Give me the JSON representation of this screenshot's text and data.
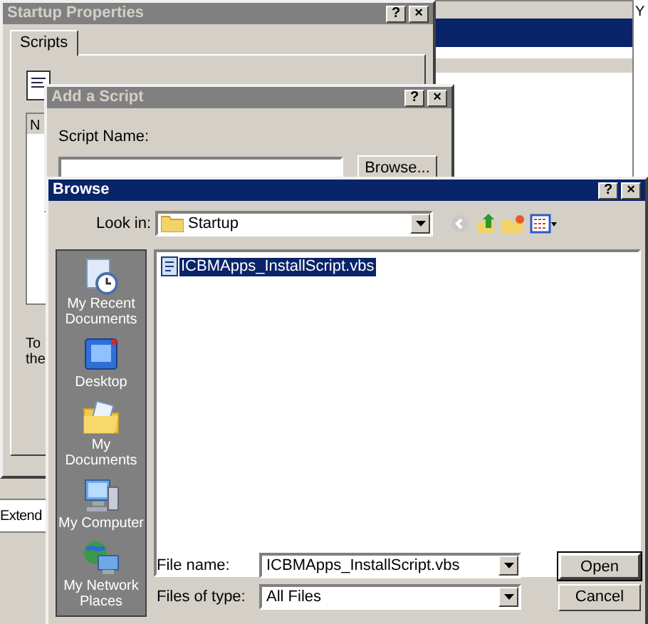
{
  "background_window": {
    "partial_text": "Y",
    "status_text": "Extend"
  },
  "startup_properties": {
    "title": "Startup Properties",
    "active": false,
    "title_buttons": [
      "?",
      "×"
    ],
    "tabs": [
      {
        "label": "Scripts",
        "selected": true
      }
    ],
    "list_header": "N",
    "partial_text_lines": [
      "To",
      "the"
    ]
  },
  "add_script": {
    "title": "Add a Script",
    "active": false,
    "title_buttons": [
      "?",
      "×"
    ],
    "script_name_label": "Script Name:",
    "browse_button": "Browse..."
  },
  "browse": {
    "title": "Browse",
    "active": true,
    "title_buttons": [
      "?",
      "×"
    ],
    "look_in_label": "Look in:",
    "look_in_value": "Startup",
    "places": [
      {
        "label": "My Recent Documents",
        "kind": "recent"
      },
      {
        "label": "Desktop",
        "kind": "desktop"
      },
      {
        "label": "My Documents",
        "kind": "documents"
      },
      {
        "label": "My Computer",
        "kind": "computer"
      },
      {
        "label": "My Network Places",
        "kind": "network"
      }
    ],
    "files": [
      {
        "name": "ICBMApps_InstallScript.vbs",
        "selected": true
      }
    ],
    "file_name_label": "File name:",
    "file_name_value": "ICBMApps_InstallScript.vbs",
    "files_of_type_label": "Files of type:",
    "files_of_type_value": "All Files",
    "open_button": "Open",
    "cancel_button": "Cancel"
  }
}
